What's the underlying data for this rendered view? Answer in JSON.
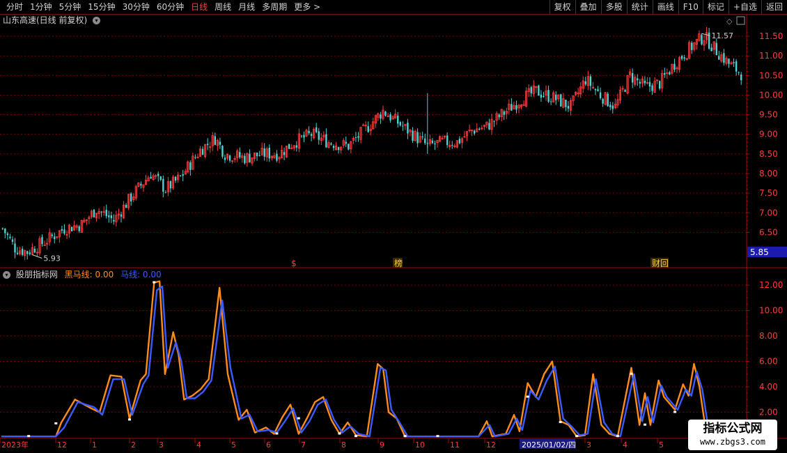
{
  "toolbar": {
    "periods": [
      "分时",
      "1分钟",
      "5分钟",
      "15分钟",
      "30分钟",
      "60分钟",
      "日线",
      "周线",
      "月线",
      "多周期",
      "更多 >"
    ],
    "active_period": "日线",
    "buttons": [
      "复权",
      "叠加",
      "多股",
      "统计",
      "画线",
      "F10",
      "标记",
      "+自选",
      "返回"
    ]
  },
  "main_panel": {
    "title": "山东高速(日线 前复权)",
    "y_ticks": [
      "11.50",
      "11.00",
      "10.50",
      "10.00",
      "9.50",
      "9.00",
      "8.50",
      "8.00",
      "7.50",
      "7.00",
      "6.50"
    ],
    "high_label": "11.57",
    "low_label": "5.93",
    "current_price": "5.85",
    "event_markers": [
      "$",
      "榜",
      "财回"
    ]
  },
  "sub_panel": {
    "title": "股朋指标网",
    "line1_label": "黑马线: 0.00",
    "line2_label": "马线: 0.00",
    "y_ticks": [
      "12.00",
      "10.00",
      "8.00",
      "6.00",
      "4.00",
      "2.00"
    ]
  },
  "x_axis": {
    "labels": [
      "2023年",
      "12",
      "1",
      "2",
      "3",
      "4",
      "5",
      "6",
      "7",
      "8",
      "9",
      "10",
      "11",
      "12",
      "2025/01/02/四",
      "3",
      "4",
      "5"
    ]
  },
  "watermark": {
    "line1": "指标公式网",
    "line2": "www.zbgs3.com"
  },
  "colors": {
    "up": "#ff3c3c",
    "down": "#4fd3d3",
    "line_orange": "#ff8c1a",
    "line_blue": "#3a5cff",
    "grid": "#7a0000",
    "axis": "#b00000"
  },
  "chart_data": [
    {
      "type": "candlestick",
      "title": "山东高速(日线 前复权)",
      "ylim": [
        5.85,
        11.75
      ],
      "price_path_keypoints": [
        [
          0,
          6.6
        ],
        [
          5,
          6.1
        ],
        [
          10,
          6.0
        ],
        [
          18,
          6.3
        ],
        [
          25,
          6.6
        ],
        [
          32,
          6.7
        ],
        [
          38,
          7.1
        ],
        [
          45,
          6.8
        ],
        [
          52,
          7.4
        ],
        [
          60,
          8.0
        ],
        [
          66,
          7.6
        ],
        [
          72,
          7.9
        ],
        [
          80,
          8.6
        ],
        [
          86,
          8.9
        ],
        [
          90,
          8.5
        ],
        [
          98,
          8.4
        ],
        [
          106,
          8.5
        ],
        [
          112,
          8.5
        ],
        [
          118,
          8.8
        ],
        [
          125,
          9.0
        ],
        [
          132,
          8.8
        ],
        [
          140,
          8.7
        ],
        [
          148,
          9.2
        ],
        [
          154,
          9.6
        ],
        [
          160,
          9.3
        ],
        [
          166,
          9.0
        ],
        [
          172,
          8.7
        ],
        [
          178,
          8.8
        ],
        [
          184,
          8.8
        ],
        [
          190,
          9.1
        ],
        [
          196,
          9.2
        ],
        [
          202,
          9.5
        ],
        [
          210,
          9.9
        ],
        [
          216,
          10.1
        ],
        [
          224,
          9.9
        ],
        [
          230,
          9.7
        ],
        [
          236,
          10.4
        ],
        [
          242,
          10.0
        ],
        [
          248,
          9.7
        ],
        [
          254,
          10.5
        ],
        [
          260,
          10.2
        ],
        [
          266,
          10.3
        ],
        [
          272,
          10.8
        ],
        [
          280,
          11.3
        ],
        [
          284,
          11.5
        ],
        [
          288,
          11.2
        ],
        [
          294,
          10.8
        ],
        [
          300,
          10.5
        ]
      ],
      "high_low": {
        "high": 11.57,
        "low": 5.93
      },
      "last": 5.85
    },
    {
      "type": "line",
      "ylim": [
        0,
        12.5
      ],
      "series": [
        {
          "name": "黑马线",
          "color": "#ff8c1a",
          "keypoints": [
            [
              0,
              0.1
            ],
            [
              20,
              0.1
            ],
            [
              22,
              1.2
            ],
            [
              27,
              3.0
            ],
            [
              33,
              2.3
            ],
            [
              36,
              2.0
            ],
            [
              40,
              4.9
            ],
            [
              44,
              4.8
            ],
            [
              47,
              1.5
            ],
            [
              51,
              4.5
            ],
            [
              53,
              5.0
            ],
            [
              56,
              12.2
            ],
            [
              58,
              12.3
            ],
            [
              60,
              5.0
            ],
            [
              63,
              8.3
            ],
            [
              65,
              6.5
            ],
            [
              67,
              3.0
            ],
            [
              70,
              3.3
            ],
            [
              73,
              3.8
            ],
            [
              76,
              4.6
            ],
            [
              80,
              11.8
            ],
            [
              83,
              5.0
            ],
            [
              87,
              1.4
            ],
            [
              90,
              2.2
            ],
            [
              93,
              0.4
            ],
            [
              97,
              0.8
            ],
            [
              100,
              0.3
            ],
            [
              103,
              1.6
            ],
            [
              106,
              2.6
            ],
            [
              109,
              0.3
            ],
            [
              112,
              1.5
            ],
            [
              115,
              2.8
            ],
            [
              118,
              3.2
            ],
            [
              121,
              1.4
            ],
            [
              124,
              0.3
            ],
            [
              127,
              1.2
            ],
            [
              130,
              0.2
            ],
            [
              134,
              0.1
            ],
            [
              138,
              5.8
            ],
            [
              140,
              5.4
            ],
            [
              142,
              2.0
            ],
            [
              145,
              1.5
            ],
            [
              148,
              0.1
            ],
            [
              155,
              0.1
            ],
            [
              165,
              0.1
            ],
            [
              175,
              0.1
            ],
            [
              178,
              1.3
            ],
            [
              180,
              0.1
            ],
            [
              185,
              0.3
            ],
            [
              188,
              1.8
            ],
            [
              190,
              0.5
            ],
            [
              193,
              4.3
            ],
            [
              196,
              3.2
            ],
            [
              199,
              5.0
            ],
            [
              202,
              6.0
            ],
            [
              205,
              1.3
            ],
            [
              208,
              1.0
            ],
            [
              211,
              0.1
            ],
            [
              214,
              0.2
            ],
            [
              217,
              5.0
            ],
            [
              220,
              1.0
            ],
            [
              223,
              0.3
            ],
            [
              226,
              0.1
            ],
            [
              231,
              5.5
            ],
            [
              234,
              1.0
            ],
            [
              236,
              3.5
            ],
            [
              238,
              1.0
            ],
            [
              241,
              4.5
            ],
            [
              243,
              3.2
            ],
            [
              247,
              2.2
            ],
            [
              250,
              4.2
            ],
            [
              252,
              3.3
            ],
            [
              254,
              5.8
            ],
            [
              256,
              4.0
            ],
            [
              258,
              1.0
            ]
          ]
        },
        {
          "name": "马线",
          "color": "#3a5cff",
          "keypoints": [
            [
              0,
              0.1
            ],
            [
              20,
              0.1
            ],
            [
              23,
              0.8
            ],
            [
              28,
              2.8
            ],
            [
              34,
              2.4
            ],
            [
              37,
              1.8
            ],
            [
              41,
              4.6
            ],
            [
              45,
              4.6
            ],
            [
              48,
              1.8
            ],
            [
              52,
              4.2
            ],
            [
              54,
              4.9
            ],
            [
              57,
              11.6
            ],
            [
              59,
              11.9
            ],
            [
              61,
              5.5
            ],
            [
              64,
              7.5
            ],
            [
              66,
              6.0
            ],
            [
              68,
              3.1
            ],
            [
              71,
              3.1
            ],
            [
              74,
              3.6
            ],
            [
              77,
              4.5
            ],
            [
              81,
              10.8
            ],
            [
              84,
              5.5
            ],
            [
              88,
              1.5
            ],
            [
              91,
              1.8
            ],
            [
              94,
              0.5
            ],
            [
              98,
              0.6
            ],
            [
              101,
              0.4
            ],
            [
              104,
              1.3
            ],
            [
              107,
              2.3
            ],
            [
              110,
              0.4
            ],
            [
              113,
              1.3
            ],
            [
              116,
              2.6
            ],
            [
              119,
              3.0
            ],
            [
              122,
              1.4
            ],
            [
              125,
              0.4
            ],
            [
              128,
              0.9
            ],
            [
              131,
              0.3
            ],
            [
              135,
              0.1
            ],
            [
              139,
              5.5
            ],
            [
              141,
              5.3
            ],
            [
              143,
              2.2
            ],
            [
              146,
              1.2
            ],
            [
              149,
              0.1
            ],
            [
              155,
              0.1
            ],
            [
              165,
              0.1
            ],
            [
              175,
              0.1
            ],
            [
              179,
              1.0
            ],
            [
              181,
              0.1
            ],
            [
              186,
              0.3
            ],
            [
              189,
              1.5
            ],
            [
              191,
              0.6
            ],
            [
              194,
              3.7
            ],
            [
              197,
              3.0
            ],
            [
              200,
              4.5
            ],
            [
              203,
              5.6
            ],
            [
              206,
              1.5
            ],
            [
              209,
              0.9
            ],
            [
              212,
              0.2
            ],
            [
              215,
              0.3
            ],
            [
              218,
              4.6
            ],
            [
              221,
              1.2
            ],
            [
              224,
              0.3
            ],
            [
              227,
              0.1
            ],
            [
              232,
              5.0
            ],
            [
              235,
              1.3
            ],
            [
              237,
              3.2
            ],
            [
              239,
              1.2
            ],
            [
              242,
              4.1
            ],
            [
              244,
              3.2
            ],
            [
              248,
              2.2
            ],
            [
              251,
              3.8
            ],
            [
              253,
              3.3
            ],
            [
              255,
              5.2
            ],
            [
              257,
              3.8
            ],
            [
              259,
              1.1
            ]
          ]
        }
      ]
    }
  ]
}
